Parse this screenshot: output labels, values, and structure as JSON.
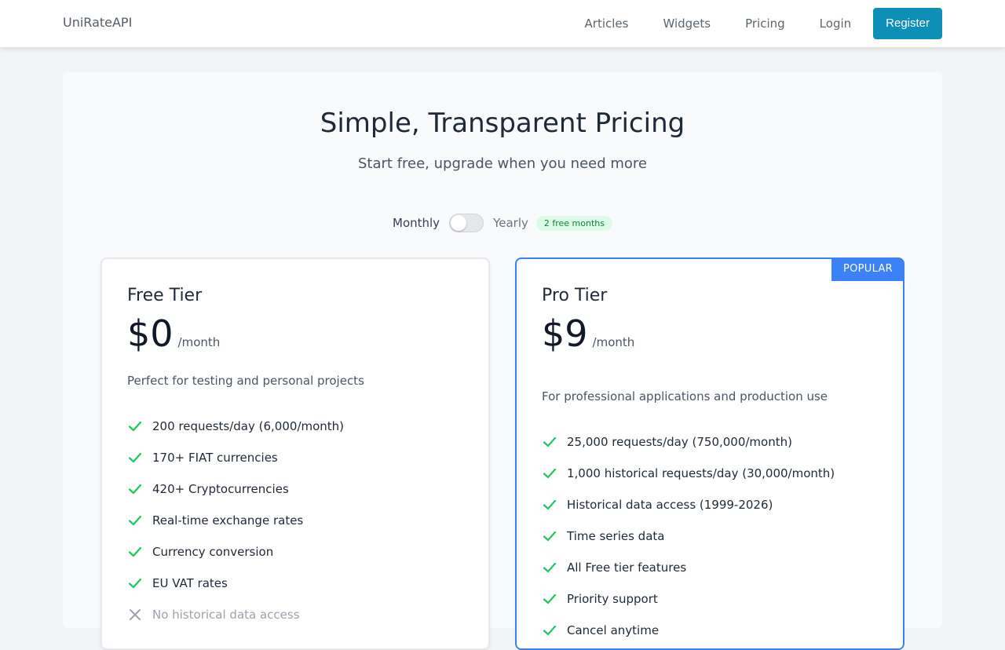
{
  "nav": {
    "brand": "UniRateAPI",
    "links": [
      "Articles",
      "Widgets",
      "Pricing",
      "Login"
    ],
    "register": "Register",
    "accent": "#0d8fb8"
  },
  "hero": {
    "title": "Simple, Transparent Pricing",
    "subtitle": "Start free, upgrade when you need more"
  },
  "billing": {
    "monthly": "Monthly",
    "yearly": "Yearly",
    "badge": "2 free months",
    "selected": "Monthly"
  },
  "plans": [
    {
      "name": "Free Tier",
      "price": "$0",
      "period": "/month",
      "description": "Perfect for testing and personal projects",
      "features": [
        {
          "text": "200 requests/day (6,000/month)",
          "included": true
        },
        {
          "text": "170+ FIAT currencies",
          "included": true
        },
        {
          "text": "420+ Cryptocurrencies",
          "included": true
        },
        {
          "text": "Real-time exchange rates",
          "included": true
        },
        {
          "text": "Currency conversion",
          "included": true
        },
        {
          "text": "EU VAT rates",
          "included": true
        },
        {
          "text": "No historical data access",
          "included": false
        }
      ]
    },
    {
      "name": "Pro Tier",
      "badge": "POPULAR",
      "price": "$9",
      "period": "/month",
      "description": "For professional applications and production use",
      "features": [
        {
          "text": "25,000 requests/day (750,000/month)",
          "included": true
        },
        {
          "text": "1,000 historical requests/day (30,000/month)",
          "included": true
        },
        {
          "text": "Historical data access (1999-2026)",
          "included": true
        },
        {
          "text": "Time series data",
          "included": true
        },
        {
          "text": "All Free tier features",
          "included": true
        },
        {
          "text": "Priority support",
          "included": true
        },
        {
          "text": "Cancel anytime",
          "included": true
        }
      ]
    }
  ],
  "colors": {
    "check": "#22c55e",
    "cross": "#9ca3af",
    "pro_border": "#3b82f6"
  },
  "icons": {
    "included": "check-icon",
    "excluded": "x-icon"
  }
}
